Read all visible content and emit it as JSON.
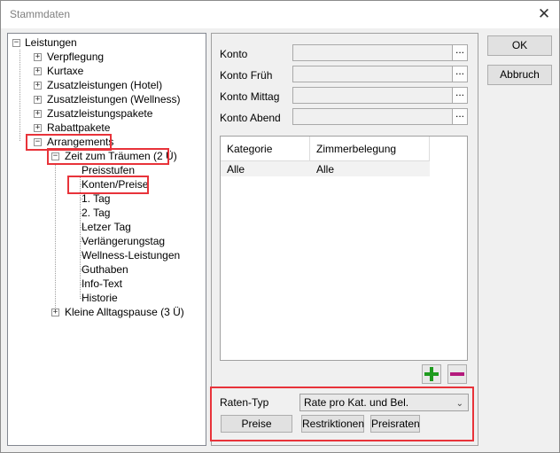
{
  "window": {
    "title": "Stammdaten",
    "close_glyph": "✕"
  },
  "tree": {
    "root": "Leistungen",
    "items": [
      "Verpflegung",
      "Kurtaxe",
      "Zusatzleistungen (Hotel)",
      "Zusatzleistungen (Wellness)",
      "Zusatzleistungspakete",
      "Rabattpakete",
      "Arrangements"
    ],
    "arrangement_1": "Zeit zum Träumen (2 Ü)",
    "arrangement_children": [
      "Preisstufen",
      "Konten/Preise",
      "1. Tag",
      "2. Tag",
      "Letzer Tag",
      "Verlängerungstag",
      "Wellness-Leistungen",
      "Guthaben",
      "Info-Text",
      "Historie"
    ],
    "arrangement_2": "Kleine Alltagspause (3 Ü)",
    "expand_glyph": "+",
    "collapse_glyph": "−"
  },
  "konto": {
    "labels": [
      "Konto",
      "Konto Früh",
      "Konto Mittag",
      "Konto Abend"
    ],
    "values": [
      "",
      "",
      "",
      ""
    ],
    "browse_glyph": "..."
  },
  "grid": {
    "headers": [
      "Kategorie",
      "Zimmerbelegung"
    ],
    "rows": [
      [
        "Alle",
        "Alle"
      ]
    ]
  },
  "icons": {
    "add": "plus-icon",
    "remove": "minus-icon",
    "add_color": "#1e9b1e",
    "remove_color": "#b4197c"
  },
  "rates": {
    "label": "Raten-Typ",
    "selected": "Rate pro Kat. und Bel.",
    "buttons": [
      "Preise",
      "Restriktionen",
      "Preisraten"
    ]
  },
  "actions": {
    "ok": "OK",
    "cancel": "Abbruch"
  },
  "colors": {
    "highlight": "#e8333a"
  }
}
